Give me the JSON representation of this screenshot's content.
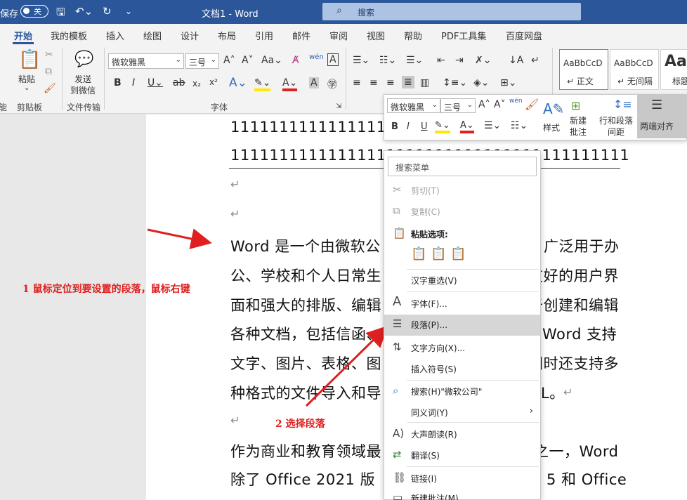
{
  "titlebar": {
    "autosave": "保存",
    "toggle_state": "关",
    "title": "文档1  -  Word",
    "search_placeholder": "搜索"
  },
  "tabs": [
    "开始",
    "我的模板",
    "插入",
    "绘图",
    "设计",
    "布局",
    "引用",
    "邮件",
    "审阅",
    "视图",
    "帮助",
    "PDF工具集",
    "百度网盘"
  ],
  "ribbon": {
    "paste_label": "粘贴",
    "send_label_1": "发送",
    "send_label_2": "到微信",
    "font_name": "微软雅黑",
    "font_size": "三号",
    "styles": [
      {
        "sample": "AaBbCcD",
        "name": "↵ 正文"
      },
      {
        "sample": "AaBbCcD",
        "name": "↵ 无间隔"
      },
      {
        "sample": "Aa",
        "name": "标题"
      }
    ],
    "groups": {
      "clipboard": "剪贴板",
      "file_transfer": "文件传输",
      "font": "字体",
      "left_cut": "能"
    }
  },
  "document": {
    "lines": [
      "11111111111111111111111111111111111111111",
      "111111111111111111111111111111111111111111",
      "Word  是一个由微软公司开发的文字处理软件，广泛用于办",
      "公、学校和个人日常生活中。它具有友好的用户界",
      "面和强大的排版、编辑功能，可以用于创建和编辑",
      "各种文档，包括信函、简历、报告等。Word  支持",
      "文字、图片、表格、图表等多种元素，同时还支持多",
      "种格式的文件导入和导出，如 PDF、HTML。",
      "作为商业和教育领域最常用的办公软件之一，Word",
      "除了  Office  2021  版本，还有  Office 365  和  Office"
    ],
    "visible_fragments": {
      "l1": "1111111111111111111",
      "l2": "11111111111111111111111111111111111111111",
      "p1a": "Word  是一个由微软公",
      "p1b": "广泛用于办",
      "p2a": "公、学校和个人日常生",
      "p2b": "友好的用户界",
      "p3a": "面和强大的排版、编辑",
      "p3b": "于创建和编辑",
      "p4a": "各种文档，包括信函、",
      "p4b": "Word  支持",
      "p5a": "文字、图片、表格、图",
      "p5b": "同时还支持多",
      "p6a": "种格式的文件导入和导",
      "p6b": "L。",
      "p7a": "作为商业和教育领域最",
      "p7b": "之一，Word",
      "p8a": "除了  Office  2021  版",
      "p8b": "5  和  Office"
    }
  },
  "annotations": {
    "step1": "1  鼠标定位到要设置的段落，鼠标右键",
    "step2": "2  选择段落"
  },
  "minibar": {
    "font_name": "微软雅黑",
    "font_size": "三号",
    "style_label": "样式",
    "new_comment_1": "新建",
    "new_comment_2": "批注",
    "line_spacing_1": "行和段落",
    "line_spacing_2": "间距",
    "justify_label": "两端对齐"
  },
  "context_menu": {
    "search_placeholder": "搜索菜单",
    "cut": "剪切(T)",
    "copy": "复制(C)",
    "paste_options": "粘贴选项:",
    "reconvert": "汉字重选(V)",
    "font": "字体(F)...",
    "paragraph": "段落(P)...",
    "text_direction": "文字方向(X)...",
    "insert_symbol": "插入符号(S)",
    "search_item": "搜索(H)\"微软公司\"",
    "synonyms": "同义词(Y)",
    "read_aloud": "大声朗读(R)",
    "translate": "翻译(S)",
    "link": "链接(I)",
    "new_comment": "新建批注(M)"
  },
  "colors": {
    "word_blue": "#2b579a",
    "annotation_red": "#e02020"
  }
}
